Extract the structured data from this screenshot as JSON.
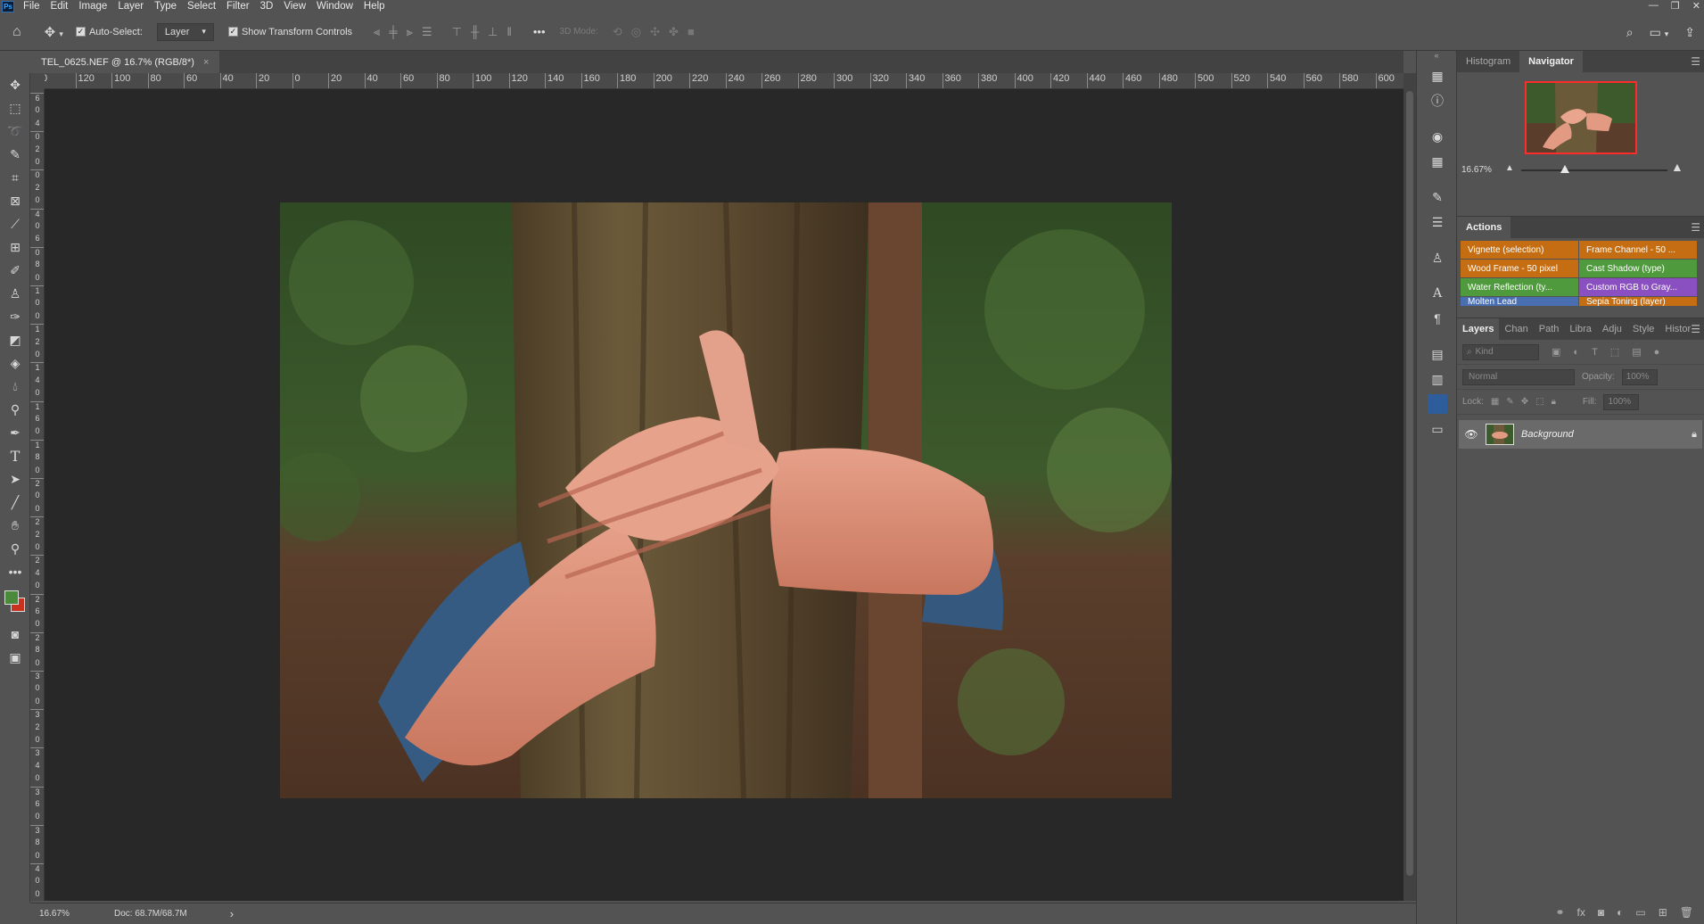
{
  "app": {
    "logo": "Ps"
  },
  "menu": [
    "File",
    "Edit",
    "Image",
    "Layer",
    "Type",
    "Select",
    "Filter",
    "3D",
    "View",
    "Window",
    "Help"
  ],
  "window_controls": [
    "—",
    "❐",
    "✕"
  ],
  "options": {
    "auto_select_label": "Auto-Select:",
    "auto_select_value": "Layer",
    "show_transform_label": "Show Transform Controls",
    "mode_3d_label": "3D Mode:"
  },
  "document": {
    "tab_title": "TEL_0625.NEF @ 16.7% (RGB/8*)",
    "tab_close": "×"
  },
  "ruler": {
    "h_ticks": [
      "0",
      "120",
      "100",
      "80",
      "60",
      "40",
      "20",
      "0",
      "20",
      "40",
      "60",
      "80",
      "100",
      "120",
      "140",
      "160",
      "180",
      "200",
      "220",
      "240",
      "260",
      "280",
      "300",
      "320",
      "340",
      "360",
      "380",
      "400",
      "420",
      "440",
      "460",
      "480",
      "500",
      "520",
      "540",
      "560",
      "580",
      "600",
      "620"
    ],
    "v_ticks": [
      "6",
      "0",
      "4",
      "0",
      "2",
      "0",
      "0",
      "2",
      "0",
      "4",
      "0",
      "6",
      "0",
      "8",
      "0",
      "1",
      "0",
      "0",
      "1",
      "2",
      "0",
      "1",
      "4",
      "0",
      "1",
      "6",
      "0",
      "1",
      "8",
      "0",
      "2",
      "0",
      "0",
      "2",
      "2",
      "0",
      "2",
      "4",
      "0",
      "2",
      "6",
      "0",
      "2",
      "8",
      "0",
      "3",
      "0",
      "0",
      "3",
      "2",
      "0",
      "3",
      "4",
      "0",
      "3",
      "6",
      "0",
      "3",
      "8",
      "0",
      "4",
      "0",
      "0"
    ]
  },
  "status": {
    "zoom": "16.67%",
    "doc": "Doc: 68.7M/68.7M",
    "arrow": "›"
  },
  "navigator": {
    "tabs": [
      "Histogram",
      "Navigator"
    ],
    "active_tab": "Navigator",
    "zoom": "16.67%",
    "zoom_fraction": 0.3
  },
  "actions": {
    "title": "Actions",
    "items": [
      {
        "label": "Vignette (selection)",
        "color": "#c46d12"
      },
      {
        "label": "Frame Channel - 50 ...",
        "color": "#c46d12"
      },
      {
        "label": "Wood Frame - 50 pixel",
        "color": "#c46d12"
      },
      {
        "label": "Cast Shadow (type)",
        "color": "#4f9a3c"
      },
      {
        "label": "Water Reflection (ty...",
        "color": "#4f9a3c"
      },
      {
        "label": "Custom RGB to Gray...",
        "color": "#8a4fc0"
      },
      {
        "label": "Molten Lead",
        "color": "#4a6fb0"
      },
      {
        "label": "Sepia Toning (layer)",
        "color": "#c46d12"
      }
    ]
  },
  "layers": {
    "tabs": [
      "Layers",
      "Chan",
      "Path",
      "Libra",
      "Adju",
      "Style",
      "Histor"
    ],
    "active_tab": "Layers",
    "kind_placeholder": "Kind",
    "blend_mode": "Normal",
    "opacity_label": "Opacity:",
    "opacity_value": "100%",
    "lock_label": "Lock:",
    "fill_label": "Fill:",
    "fill_value": "100%",
    "items": [
      {
        "name": "Background",
        "visible": true,
        "locked": true
      }
    ]
  },
  "colors": {
    "foreground": "#4a8a3a",
    "background": "#c8321e",
    "accent": "#2d5d9a"
  }
}
